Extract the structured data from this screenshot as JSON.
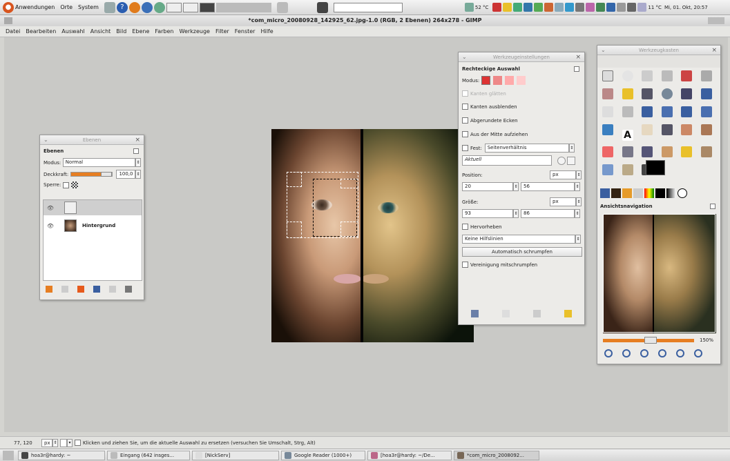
{
  "top_panel": {
    "menus": [
      "Anwendungen",
      "Orte",
      "System"
    ],
    "temp1": "52 °C",
    "temp2": "11 °C",
    "clock": "Mi, 01. Okt, 20:57"
  },
  "window": {
    "title": "*com_micro_20080928_142925_62.jpg-1.0 (RGB, 2 Ebenen) 264x278 - GIMP"
  },
  "menubar": {
    "items": [
      "Datei",
      "Bearbeiten",
      "Auswahl",
      "Ansicht",
      "Bild",
      "Ebene",
      "Farben",
      "Werkzeuge",
      "Filter",
      "Fenster",
      "Hilfe"
    ]
  },
  "layers_dialog": {
    "title": "Ebenen",
    "header": "Ebenen",
    "mode_label": "Modus:",
    "mode_value": "Normal",
    "opacity_label": "Deckkraft:",
    "opacity_value": "100,0",
    "opacity_fraction": 1.0,
    "lock_label": "Sperre:",
    "layers": [
      {
        "name": ""
      },
      {
        "name": "Hintergrund"
      }
    ]
  },
  "tool_options": {
    "title": "Werkzeugeinstellungen",
    "header": "Rechteckige Auswahl",
    "mode_label": "Modus:",
    "antialias": "Kanten glätten",
    "feather": "Kanten ausblenden",
    "rounded": "Abgerundete Ecken",
    "expand_center": "Aus der Mitte aufziehen",
    "fixed_label": "Fest:",
    "fixed_value": "Seitenverhältnis",
    "current": "Aktuell",
    "position_label": "Position:",
    "position_unit": "px",
    "pos_x": "20",
    "pos_y": "56",
    "size_label": "Größe:",
    "size_unit": "px",
    "size_w": "93",
    "size_h": "86",
    "highlight": "Hervorheben",
    "guides": "Keine Hilfslinien",
    "auto_shrink": "Automatisch schrumpfen",
    "shrink_merged": "Vereinigung mitschrumpfen"
  },
  "toolbox": {
    "title": "Werkzeugkasten"
  },
  "navigation": {
    "header": "Ansichtsnavigation",
    "zoom": "150%",
    "zoom_fraction": 0.5
  },
  "status_bar": {
    "coords": "77, 120",
    "unit": "px",
    "message": "Klicken und ziehen Sie, um die aktuelle Auswahl zu ersetzen (versuchen Sie Umschalt, Strg, Alt)"
  },
  "taskbar": {
    "items": [
      "hoa3r@hardy: ~",
      "Eingang (642 insges...",
      "[NickServ]",
      "Google Reader (1000+)",
      "[hoa3r@hardy: ~/De...",
      "*com_micro_2008092..."
    ]
  }
}
